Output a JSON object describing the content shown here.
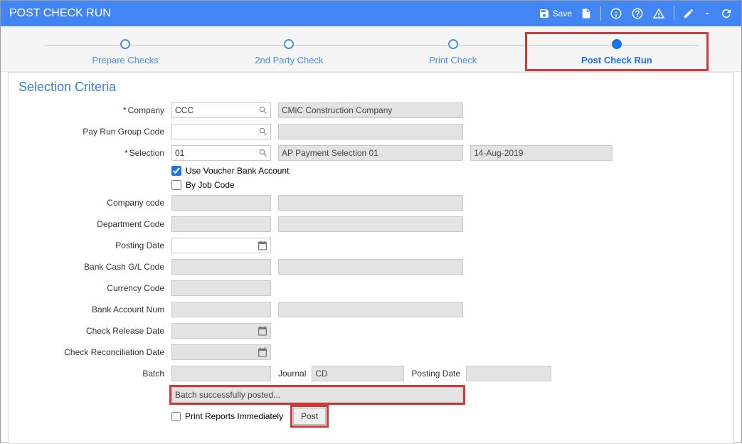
{
  "header": {
    "title": "POST CHECK RUN",
    "save_label": "Save"
  },
  "stepper": {
    "steps": [
      "Prepare Checks",
      "2nd Party Check",
      "Print Check",
      "Post Check Run"
    ]
  },
  "section_title": "Selection Criteria",
  "labels": {
    "company": "Company",
    "pay_run_group_code": "Pay Run Group Code",
    "selection": "Selection",
    "use_voucher_bank_account": "Use Voucher Bank Account",
    "by_job_code": "By Job Code",
    "company_code": "Company code",
    "department_code": "Department Code",
    "posting_date": "Posting Date",
    "bank_cash_gl_code": "Bank Cash G/L Code",
    "currency_code": "Currency Code",
    "bank_account_num": "Bank Account Num",
    "check_release_date": "Check Release Date",
    "check_reconciliation_date": "Check Reconciliation Date",
    "batch": "Batch",
    "journal": "Journal",
    "posting_date2": "Posting Date",
    "print_reports_immediately": "Print Reports Immediately",
    "post": "Post"
  },
  "values": {
    "company": "CCC",
    "company_name": "CMiC Construction Company",
    "pay_run_group_code": "",
    "pay_run_group_name": "",
    "selection": "01",
    "selection_name": "AP Payment Selection 01",
    "selection_date": "14-Aug-2019",
    "use_voucher_bank_account": true,
    "by_job_code": false,
    "company_code": "",
    "company_code_name": "",
    "department_code": "",
    "department_code_name": "",
    "posting_date": "",
    "bank_cash_gl_code": "",
    "bank_cash_gl_name": "",
    "currency_code": "",
    "bank_account_num": "",
    "bank_account_name": "",
    "check_release_date": "",
    "check_reconciliation_date": "",
    "batch": "",
    "journal": "CD",
    "posting_date2": "",
    "status_message": "Batch successfully posted...",
    "print_reports_immediately": false
  }
}
